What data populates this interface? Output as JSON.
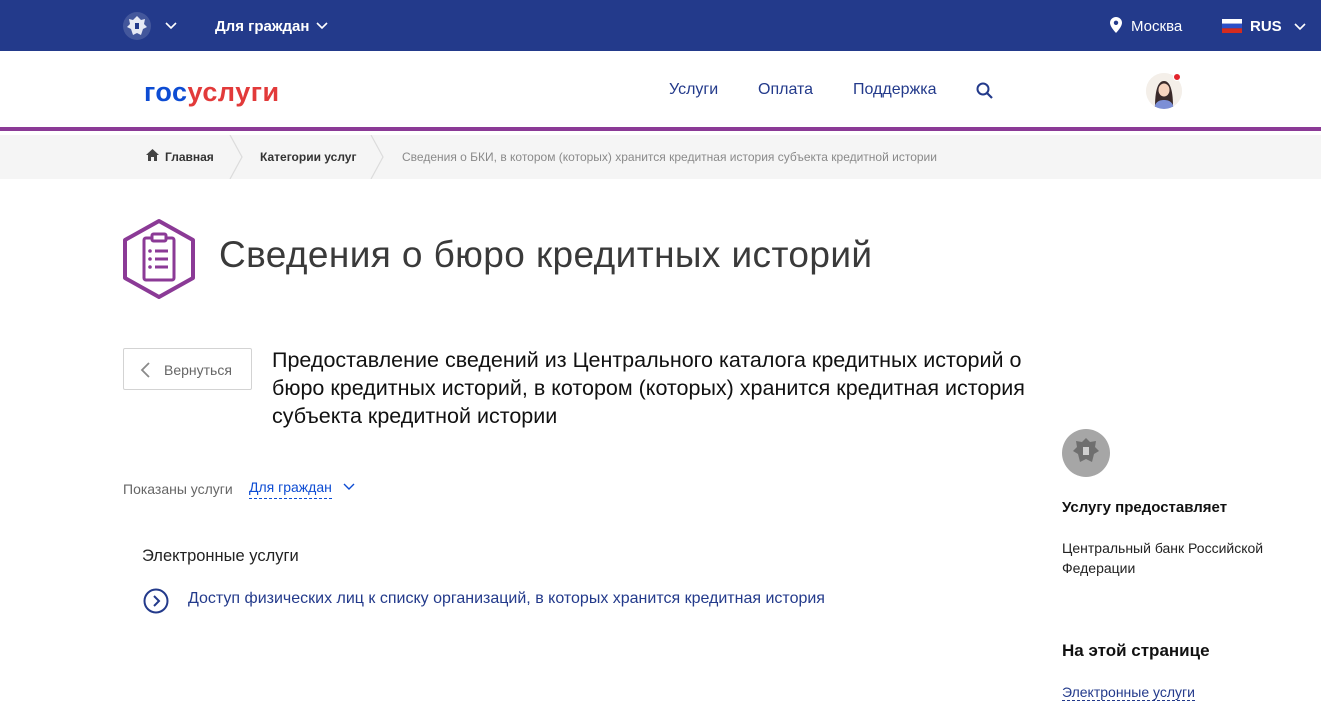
{
  "topbar": {
    "audience": "Для граждан",
    "city": "Москва",
    "language": "RUS",
    "icons": [
      "emblem-icon",
      "chevron-down-icon",
      "location-pin-icon",
      "russia-flag-icon"
    ]
  },
  "header": {
    "logo_part1": "гос",
    "logo_part2": "услуги",
    "nav": [
      "Услуги",
      "Оплата",
      "Поддержка"
    ],
    "icons": [
      "search-icon",
      "avatar"
    ]
  },
  "breadcrumbs": {
    "home": "Главная",
    "category": "Категории услуг",
    "current": "Сведения о БКИ, в котором (которых) хранится кредитная история субъекта кредитной истории"
  },
  "page": {
    "title": "Сведения о бюро кредитных историй",
    "back": "Вернуться",
    "service_title": "Предоставление сведений из Центрального каталога кредитных историй о бюро кредитных историй, в котором (которых) хранится кредитная история субъекта кредитной истории",
    "shown_label": "Показаны услуги",
    "shown_value": "Для граждан",
    "section": "Электронные услуги",
    "service_link": "Доступ физических лиц к списку организаций, в которых хранится кредитная история"
  },
  "sidebar": {
    "provider_heading": "Услугу предоставляет",
    "provider": "Центральный банк Российской Федерации",
    "onpage_heading": "На этой странице",
    "onpage_link": "Электронные услуги"
  },
  "colors": {
    "topbar": "#233a8b",
    "accent_purple": "#8b3a96",
    "logo_blue": "#0d4cd3",
    "logo_red": "#e23a3a"
  }
}
